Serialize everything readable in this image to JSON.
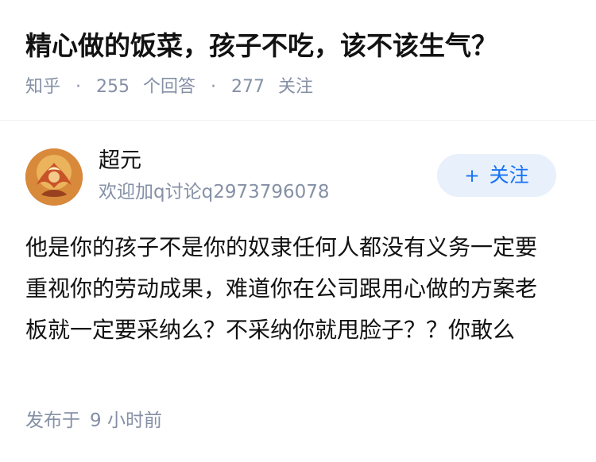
{
  "question": {
    "title": "精心做的饭菜，孩子不吃，该不该生气？",
    "source": "知乎",
    "separator": "·",
    "answer_count": "255",
    "answer_label": "个回答",
    "follower_count": "277",
    "follower_label": "关注"
  },
  "answer": {
    "author": {
      "name": "超元",
      "bio": "欢迎加q讨论q2973796078",
      "avatar_icon": "phoenix-avatar"
    },
    "follow_button": {
      "icon": "+",
      "label": "关注"
    },
    "content": "他是你的孩子不是你的奴隶任何人都没有义务一定要重视你的劳动成果，难道你在公司跟用心做的方案老板就一定要采纳么？不采纳你就甩脸子？？你敢么",
    "published_label": "发布于",
    "published_time": "9 小时前"
  },
  "colors": {
    "text_primary": "#121212",
    "text_secondary": "#8590a6",
    "accent_blue": "#1772f6",
    "follow_bg": "#e8f0fb",
    "divider": "#f0f2f7"
  }
}
